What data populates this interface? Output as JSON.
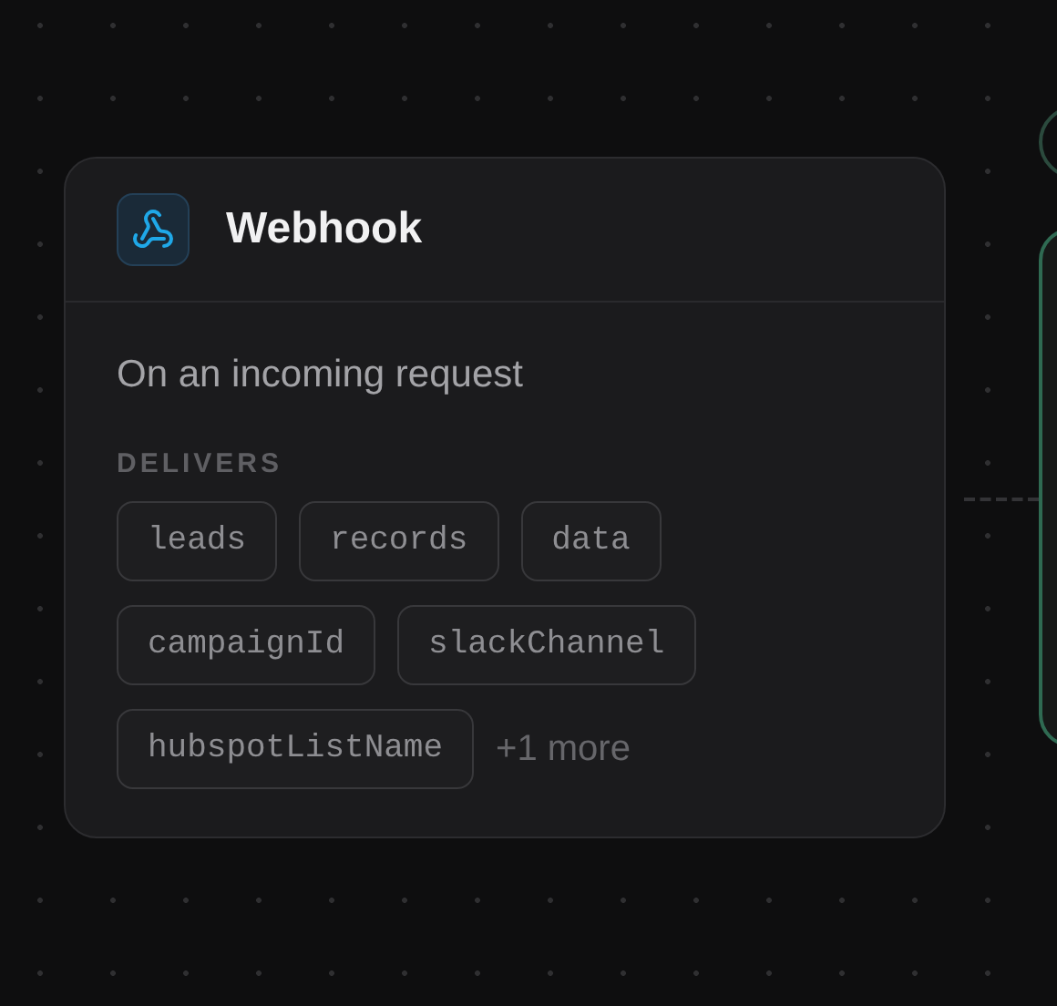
{
  "node": {
    "title": "Webhook",
    "description": "On an incoming request",
    "section_label": "DELIVERS",
    "outputs": [
      "leads",
      "records",
      "data",
      "campaignId",
      "slackChannel",
      "hubspotListName"
    ],
    "more": "+1 more"
  }
}
